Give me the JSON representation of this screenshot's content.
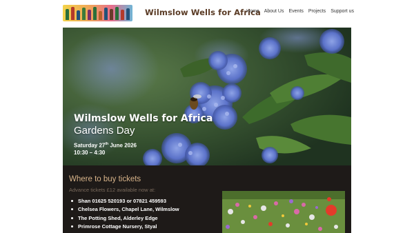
{
  "header": {
    "site_title": "Wilmslow Wells for Africa",
    "nav": [
      "Home",
      "About Us",
      "Events",
      "Projects",
      "Support us"
    ]
  },
  "hero": {
    "title": "Wilmslow Wells for Africa",
    "subtitle": "Gardens Day",
    "date_prefix": "Saturday 27",
    "date_sup": "th",
    "date_suffix": " June 2026",
    "time": "10:30 – 4:30"
  },
  "tickets": {
    "heading": "Where to buy tickets",
    "subheading": "Advance tickets £12 available now at:",
    "items": [
      "Shan 01625 520193 or 07821 459593",
      "Chelsea Flowers, Chapel Lane, Wilmslow",
      "The Potting Shed, Alderley Edge",
      "Primrose Cottage Nursery, Styal"
    ]
  },
  "colors": {
    "title_brown": "#5a3b25",
    "dark_bg": "#1e1a18",
    "heading_tan": "#d8b48a"
  }
}
